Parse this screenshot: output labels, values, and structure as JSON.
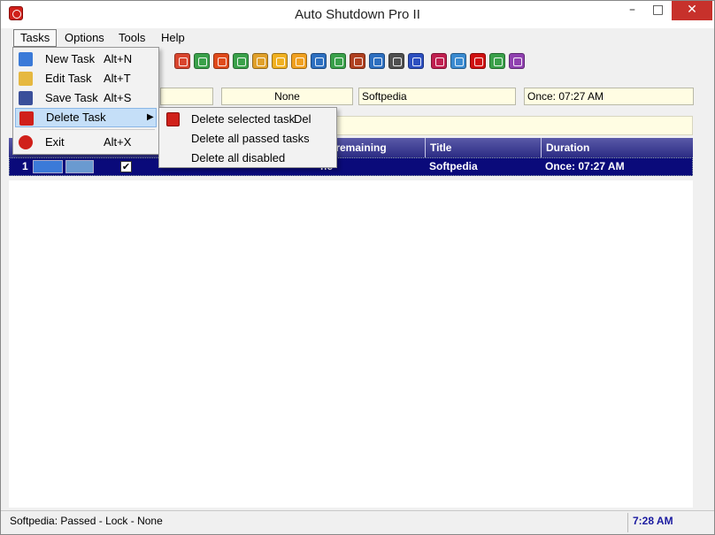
{
  "window": {
    "title": "Auto Shutdown Pro II"
  },
  "titlebar": {
    "minimize": "–",
    "maximize": "□",
    "close": "✕"
  },
  "menubar": {
    "items": [
      "Tasks",
      "Options",
      "Tools",
      "Help"
    ]
  },
  "toolbar": {
    "buttons": [
      {
        "name": "tool-arrow-left-icon",
        "color": "#d9452e"
      },
      {
        "name": "tool-arrow-right-icon",
        "color": "#3aa14a"
      },
      {
        "name": "tool-power-icon",
        "color": "#e04a1b"
      },
      {
        "name": "tool-recycle-icon",
        "color": "#3aa14a"
      },
      {
        "name": "tool-key-icon",
        "color": "#e0a02a"
      },
      {
        "name": "tool-lock-icon",
        "color": "#f0b020"
      },
      {
        "name": "tool-standby-icon",
        "color": "#f0a020"
      },
      {
        "name": "tool-shutdown-blue-icon",
        "color": "#2d6fc0"
      },
      {
        "name": "tool-restart-icon",
        "color": "#3aa14a"
      },
      {
        "name": "tool-hibernate-icon",
        "color": "#b04020"
      },
      {
        "name": "tool-info-icon",
        "color": "#2d6fc0"
      },
      {
        "name": "tool-camera-icon",
        "color": "#505050"
      },
      {
        "name": "tool-help-icon",
        "color": "#2d4fc0"
      },
      {
        "name": "tool-ftp-icon",
        "color": "#c02050"
      },
      {
        "name": "tool-checklist-icon",
        "color": "#3a8ad0"
      },
      {
        "name": "tool-red-arrow-icon",
        "color": "#d01010"
      },
      {
        "name": "tool-network-icon",
        "color": "#3aa14a"
      },
      {
        "name": "tool-tools-icon",
        "color": "#9040b0"
      }
    ]
  },
  "fields": {
    "none": "None",
    "title": "Softpedia",
    "duration": "Once: 07:27 AM"
  },
  "table": {
    "headers": [
      "ne remaining",
      "Title",
      "Duration"
    ],
    "rows": [
      {
        "num": "1",
        "checked": "✔",
        "remaining": "ne",
        "title": "Softpedia",
        "duration": "Once: 07:27 AM"
      }
    ]
  },
  "tasks_menu": {
    "items": [
      {
        "label": "New Task",
        "shortcut": "Alt+N"
      },
      {
        "label": "Edit Task",
        "shortcut": "Alt+T"
      },
      {
        "label": "Save Task",
        "shortcut": "Alt+S"
      },
      {
        "label": "Delete Task",
        "shortcut": "",
        "submenu": "▶"
      },
      {
        "label": "Exit",
        "shortcut": "Alt+X"
      }
    ]
  },
  "delete_submenu": {
    "items": [
      {
        "label": "Delete selected task",
        "shortcut": "Del"
      },
      {
        "label": "Delete all passed tasks",
        "shortcut": ""
      },
      {
        "label": "Delete all disabled",
        "shortcut": ""
      }
    ]
  },
  "statusbar": {
    "message": "Softpedia:  Passed - Lock - None",
    "time": "7:28 AM"
  }
}
